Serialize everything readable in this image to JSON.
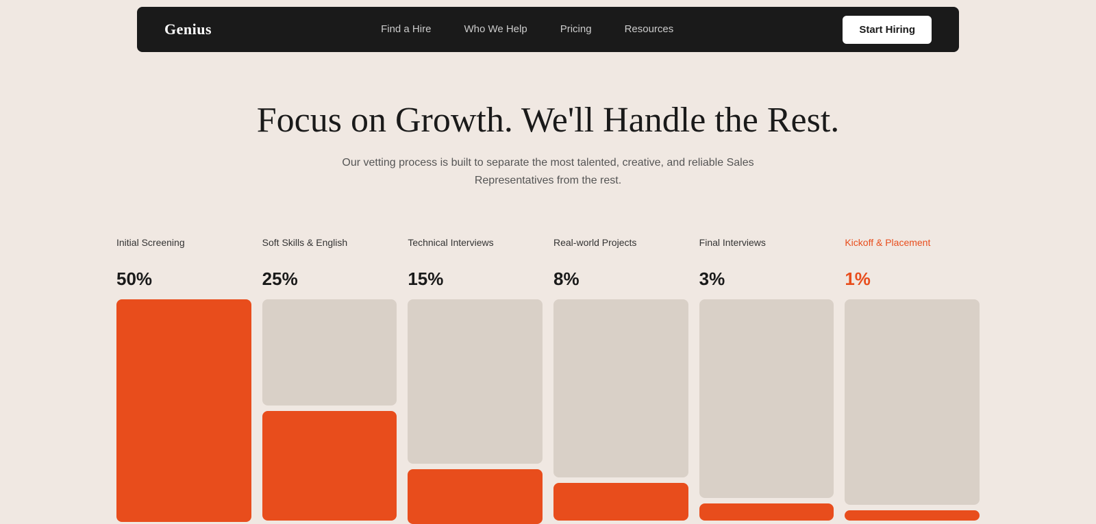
{
  "nav": {
    "logo": "Genius",
    "links": [
      {
        "label": "Find a Hire",
        "href": "#"
      },
      {
        "label": "Who We Help",
        "href": "#"
      },
      {
        "label": "Pricing",
        "href": "#"
      },
      {
        "label": "Resources",
        "href": "#"
      }
    ],
    "cta_label": "Start Hiring"
  },
  "hero": {
    "title": "Focus on Growth. We'll Handle the Rest.",
    "subtitle": "Our vetting process is built to separate the most talented, creative, and reliable Sales Representatives from the rest."
  },
  "stages": [
    {
      "label": "Initial Screening",
      "percent": "50%",
      "highlight": false,
      "top_color": "#e84d1c",
      "top_height": 210,
      "bottom_color": "#e84d1c",
      "bottom_height": 115,
      "has_bottom": false,
      "full_height": 325
    },
    {
      "label": "Soft Skills & English",
      "percent": "25%",
      "highlight": false,
      "top_color": "#d9d0c7",
      "top_height": 155,
      "bottom_color": "#e84d1c",
      "bottom_height": 160,
      "has_bottom": true
    },
    {
      "label": "Technical Interviews",
      "percent": "15%",
      "highlight": false,
      "top_color": "#d9d0c7",
      "top_height": 240,
      "bottom_color": "#e84d1c",
      "bottom_height": 80,
      "has_bottom": true
    },
    {
      "label": "Real-world Projects",
      "percent": "8%",
      "highlight": false,
      "top_color": "#d9d0c7",
      "top_height": 260,
      "bottom_color": "#e84d1c",
      "bottom_height": 55,
      "has_bottom": true
    },
    {
      "label": "Final Interviews",
      "percent": "3%",
      "highlight": false,
      "top_color": "#d9d0c7",
      "top_height": 290,
      "bottom_color": "#e84d1c",
      "bottom_height": 25,
      "has_bottom": true
    },
    {
      "label": "Kickoff & Placement",
      "percent": "1%",
      "highlight": true,
      "top_color": "#d9d0c7",
      "top_height": 300,
      "bottom_color": "#e84d1c",
      "bottom_height": 15,
      "has_bottom": true
    }
  ],
  "colors": {
    "orange": "#e84d1c",
    "beige": "#d9d0c7",
    "bg": "#f0e8e2",
    "dark": "#1a1a1a",
    "highlight_text": "#e84d1c"
  }
}
